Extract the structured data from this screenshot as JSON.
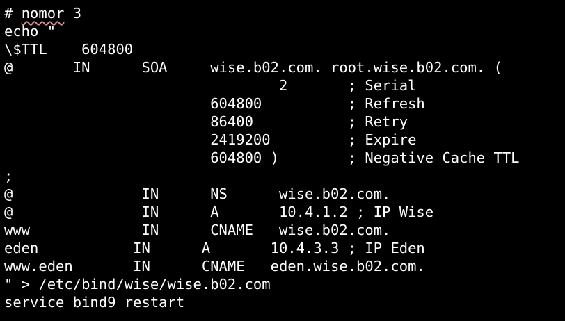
{
  "theme": {
    "background": "#000000",
    "foreground": "#ffffff",
    "spellcheck_underline": "#d98c8c"
  },
  "terminal": {
    "first_line": {
      "prefix": "# ",
      "misspelled_word": "nomor",
      "suffix": " 3"
    },
    "lines": [
      "echo \"",
      "\\$TTL    604800",
      "@       IN      SOA     wise.b02.com. root.wise.b02.com. (",
      "                                2       ; Serial",
      "                        604800          ; Refresh",
      "                        86400           ; Retry",
      "                        2419200         ; Expire",
      "                        604800 )        ; Negative Cache TTL",
      ";",
      "@               IN      NS      wise.b02.com.",
      "@               IN      A       10.4.1.2 ; IP Wise",
      "www             IN      CNAME   wise.b02.com.",
      "eden           IN      A       10.4.3.3 ; IP Eden",
      "www.eden       IN      CNAME   eden.wise.b02.com.",
      "\" > /etc/bind/wise/wise.b02.com",
      "service bind9 restart"
    ]
  }
}
